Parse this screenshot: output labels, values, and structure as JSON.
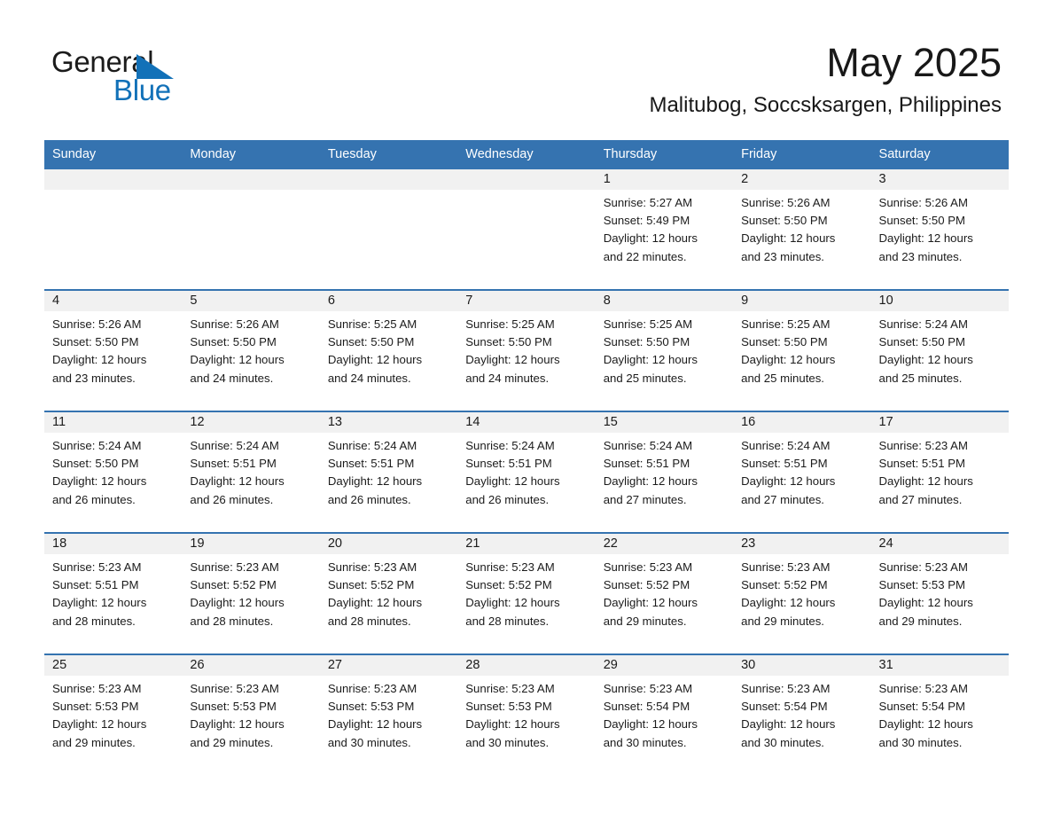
{
  "brand": {
    "name_part1": "General",
    "name_part2": "Blue",
    "triangle_color": "#1271b8",
    "blue_color": "#1271b8"
  },
  "header": {
    "month_title": "May 2025",
    "location": "Malitubog, Soccsksargen, Philippines"
  },
  "theme": {
    "header_blue": "#3573b0",
    "date_band_gray": "#f1f1f1",
    "separator_blue": "#3573b0",
    "text_color": "#1b1b1b"
  },
  "calendar": {
    "weekday_headers": [
      "Sunday",
      "Monday",
      "Tuesday",
      "Wednesday",
      "Thursday",
      "Friday",
      "Saturday"
    ],
    "weeks": [
      [
        {
          "day": "",
          "blank": true,
          "sunrise": "",
          "sunset": "",
          "daylight_line1": "",
          "daylight_line2": ""
        },
        {
          "day": "",
          "blank": true,
          "sunrise": "",
          "sunset": "",
          "daylight_line1": "",
          "daylight_line2": ""
        },
        {
          "day": "",
          "blank": true,
          "sunrise": "",
          "sunset": "",
          "daylight_line1": "",
          "daylight_line2": ""
        },
        {
          "day": "",
          "blank": true,
          "sunrise": "",
          "sunset": "",
          "daylight_line1": "",
          "daylight_line2": ""
        },
        {
          "day": "1",
          "blank": false,
          "sunrise": "Sunrise: 5:27 AM",
          "sunset": "Sunset: 5:49 PM",
          "daylight_line1": "Daylight: 12 hours",
          "daylight_line2": "and 22 minutes."
        },
        {
          "day": "2",
          "blank": false,
          "sunrise": "Sunrise: 5:26 AM",
          "sunset": "Sunset: 5:50 PM",
          "daylight_line1": "Daylight: 12 hours",
          "daylight_line2": "and 23 minutes."
        },
        {
          "day": "3",
          "blank": false,
          "sunrise": "Sunrise: 5:26 AM",
          "sunset": "Sunset: 5:50 PM",
          "daylight_line1": "Daylight: 12 hours",
          "daylight_line2": "and 23 minutes."
        }
      ],
      [
        {
          "day": "4",
          "blank": false,
          "sunrise": "Sunrise: 5:26 AM",
          "sunset": "Sunset: 5:50 PM",
          "daylight_line1": "Daylight: 12 hours",
          "daylight_line2": "and 23 minutes."
        },
        {
          "day": "5",
          "blank": false,
          "sunrise": "Sunrise: 5:26 AM",
          "sunset": "Sunset: 5:50 PM",
          "daylight_line1": "Daylight: 12 hours",
          "daylight_line2": "and 24 minutes."
        },
        {
          "day": "6",
          "blank": false,
          "sunrise": "Sunrise: 5:25 AM",
          "sunset": "Sunset: 5:50 PM",
          "daylight_line1": "Daylight: 12 hours",
          "daylight_line2": "and 24 minutes."
        },
        {
          "day": "7",
          "blank": false,
          "sunrise": "Sunrise: 5:25 AM",
          "sunset": "Sunset: 5:50 PM",
          "daylight_line1": "Daylight: 12 hours",
          "daylight_line2": "and 24 minutes."
        },
        {
          "day": "8",
          "blank": false,
          "sunrise": "Sunrise: 5:25 AM",
          "sunset": "Sunset: 5:50 PM",
          "daylight_line1": "Daylight: 12 hours",
          "daylight_line2": "and 25 minutes."
        },
        {
          "day": "9",
          "blank": false,
          "sunrise": "Sunrise: 5:25 AM",
          "sunset": "Sunset: 5:50 PM",
          "daylight_line1": "Daylight: 12 hours",
          "daylight_line2": "and 25 minutes."
        },
        {
          "day": "10",
          "blank": false,
          "sunrise": "Sunrise: 5:24 AM",
          "sunset": "Sunset: 5:50 PM",
          "daylight_line1": "Daylight: 12 hours",
          "daylight_line2": "and 25 minutes."
        }
      ],
      [
        {
          "day": "11",
          "blank": false,
          "sunrise": "Sunrise: 5:24 AM",
          "sunset": "Sunset: 5:50 PM",
          "daylight_line1": "Daylight: 12 hours",
          "daylight_line2": "and 26 minutes."
        },
        {
          "day": "12",
          "blank": false,
          "sunrise": "Sunrise: 5:24 AM",
          "sunset": "Sunset: 5:51 PM",
          "daylight_line1": "Daylight: 12 hours",
          "daylight_line2": "and 26 minutes."
        },
        {
          "day": "13",
          "blank": false,
          "sunrise": "Sunrise: 5:24 AM",
          "sunset": "Sunset: 5:51 PM",
          "daylight_line1": "Daylight: 12 hours",
          "daylight_line2": "and 26 minutes."
        },
        {
          "day": "14",
          "blank": false,
          "sunrise": "Sunrise: 5:24 AM",
          "sunset": "Sunset: 5:51 PM",
          "daylight_line1": "Daylight: 12 hours",
          "daylight_line2": "and 26 minutes."
        },
        {
          "day": "15",
          "blank": false,
          "sunrise": "Sunrise: 5:24 AM",
          "sunset": "Sunset: 5:51 PM",
          "daylight_line1": "Daylight: 12 hours",
          "daylight_line2": "and 27 minutes."
        },
        {
          "day": "16",
          "blank": false,
          "sunrise": "Sunrise: 5:24 AM",
          "sunset": "Sunset: 5:51 PM",
          "daylight_line1": "Daylight: 12 hours",
          "daylight_line2": "and 27 minutes."
        },
        {
          "day": "17",
          "blank": false,
          "sunrise": "Sunrise: 5:23 AM",
          "sunset": "Sunset: 5:51 PM",
          "daylight_line1": "Daylight: 12 hours",
          "daylight_line2": "and 27 minutes."
        }
      ],
      [
        {
          "day": "18",
          "blank": false,
          "sunrise": "Sunrise: 5:23 AM",
          "sunset": "Sunset: 5:51 PM",
          "daylight_line1": "Daylight: 12 hours",
          "daylight_line2": "and 28 minutes."
        },
        {
          "day": "19",
          "blank": false,
          "sunrise": "Sunrise: 5:23 AM",
          "sunset": "Sunset: 5:52 PM",
          "daylight_line1": "Daylight: 12 hours",
          "daylight_line2": "and 28 minutes."
        },
        {
          "day": "20",
          "blank": false,
          "sunrise": "Sunrise: 5:23 AM",
          "sunset": "Sunset: 5:52 PM",
          "daylight_line1": "Daylight: 12 hours",
          "daylight_line2": "and 28 minutes."
        },
        {
          "day": "21",
          "blank": false,
          "sunrise": "Sunrise: 5:23 AM",
          "sunset": "Sunset: 5:52 PM",
          "daylight_line1": "Daylight: 12 hours",
          "daylight_line2": "and 28 minutes."
        },
        {
          "day": "22",
          "blank": false,
          "sunrise": "Sunrise: 5:23 AM",
          "sunset": "Sunset: 5:52 PM",
          "daylight_line1": "Daylight: 12 hours",
          "daylight_line2": "and 29 minutes."
        },
        {
          "day": "23",
          "blank": false,
          "sunrise": "Sunrise: 5:23 AM",
          "sunset": "Sunset: 5:52 PM",
          "daylight_line1": "Daylight: 12 hours",
          "daylight_line2": "and 29 minutes."
        },
        {
          "day": "24",
          "blank": false,
          "sunrise": "Sunrise: 5:23 AM",
          "sunset": "Sunset: 5:53 PM",
          "daylight_line1": "Daylight: 12 hours",
          "daylight_line2": "and 29 minutes."
        }
      ],
      [
        {
          "day": "25",
          "blank": false,
          "sunrise": "Sunrise: 5:23 AM",
          "sunset": "Sunset: 5:53 PM",
          "daylight_line1": "Daylight: 12 hours",
          "daylight_line2": "and 29 minutes."
        },
        {
          "day": "26",
          "blank": false,
          "sunrise": "Sunrise: 5:23 AM",
          "sunset": "Sunset: 5:53 PM",
          "daylight_line1": "Daylight: 12 hours",
          "daylight_line2": "and 29 minutes."
        },
        {
          "day": "27",
          "blank": false,
          "sunrise": "Sunrise: 5:23 AM",
          "sunset": "Sunset: 5:53 PM",
          "daylight_line1": "Daylight: 12 hours",
          "daylight_line2": "and 30 minutes."
        },
        {
          "day": "28",
          "blank": false,
          "sunrise": "Sunrise: 5:23 AM",
          "sunset": "Sunset: 5:53 PM",
          "daylight_line1": "Daylight: 12 hours",
          "daylight_line2": "and 30 minutes."
        },
        {
          "day": "29",
          "blank": false,
          "sunrise": "Sunrise: 5:23 AM",
          "sunset": "Sunset: 5:54 PM",
          "daylight_line1": "Daylight: 12 hours",
          "daylight_line2": "and 30 minutes."
        },
        {
          "day": "30",
          "blank": false,
          "sunrise": "Sunrise: 5:23 AM",
          "sunset": "Sunset: 5:54 PM",
          "daylight_line1": "Daylight: 12 hours",
          "daylight_line2": "and 30 minutes."
        },
        {
          "day": "31",
          "blank": false,
          "sunrise": "Sunrise: 5:23 AM",
          "sunset": "Sunset: 5:54 PM",
          "daylight_line1": "Daylight: 12 hours",
          "daylight_line2": "and 30 minutes."
        }
      ]
    ]
  }
}
